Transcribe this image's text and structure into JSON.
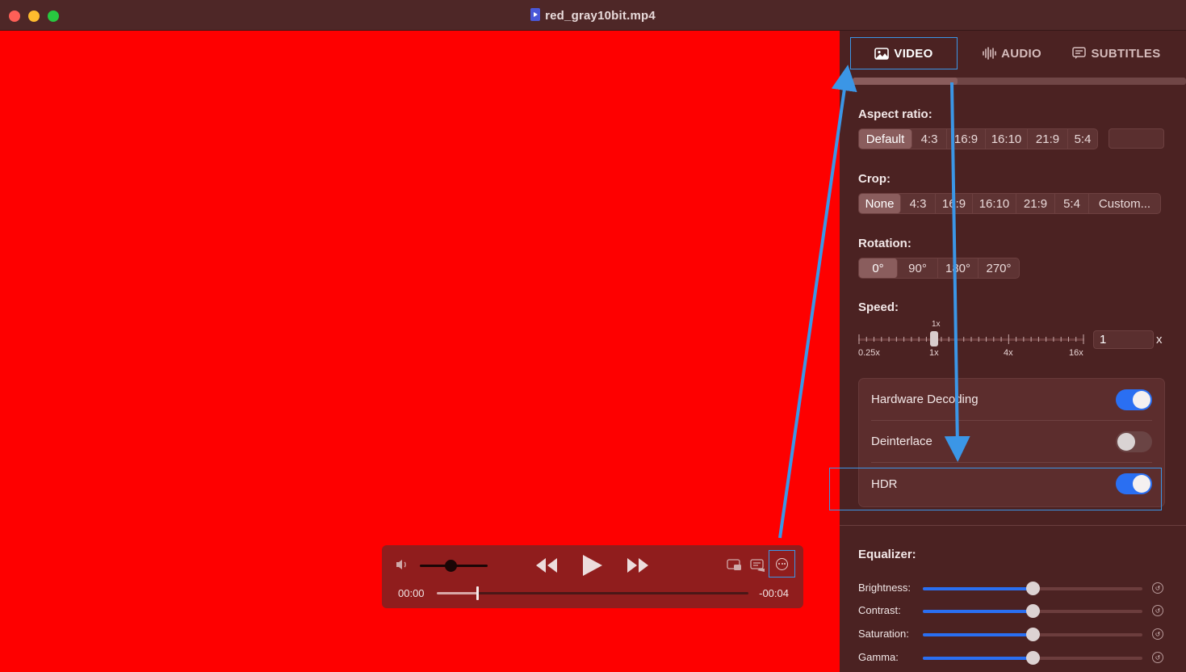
{
  "window": {
    "title": "red_gray10bit.mp4"
  },
  "colors": {
    "video_bg": "#fe0000",
    "accent": "#2a6ff2",
    "highlight": "#3b96e6"
  },
  "controls": {
    "time_current": "00:00",
    "time_remaining": "-00:04",
    "volume_level": 0.45,
    "seek_progress": 0.13,
    "icons": [
      "speaker-icon",
      "rewind-icon",
      "play-icon",
      "fast-forward-icon",
      "picture-in-picture-icon",
      "subtitles-icon",
      "more-options-icon"
    ]
  },
  "tabs": [
    {
      "label": "VIDEO",
      "icon": "image-icon",
      "selected": true
    },
    {
      "label": "AUDIO",
      "icon": "waveform-icon",
      "selected": false
    },
    {
      "label": "SUBTITLES",
      "icon": "caption-bubble-icon",
      "selected": false
    }
  ],
  "aspect": {
    "label": "Aspect ratio:",
    "options": [
      "Default",
      "4:3",
      "16:9",
      "16:10",
      "21:9",
      "5:4"
    ],
    "selected": "Default",
    "custom_value": ""
  },
  "crop": {
    "label": "Crop:",
    "options": [
      "None",
      "4:3",
      "16:9",
      "16:10",
      "21:9",
      "5:4",
      "Custom..."
    ],
    "selected": "None"
  },
  "rotation": {
    "label": "Rotation:",
    "options": [
      "0°",
      "90°",
      "180°",
      "270°"
    ],
    "selected": "0°"
  },
  "speed": {
    "label": "Speed:",
    "current_marker": "1x",
    "tick_labels": [
      "0.25x",
      "1x",
      "4x",
      "16x"
    ],
    "value": "1",
    "unit": "x"
  },
  "toggles": [
    {
      "label": "Hardware Decoding",
      "on": true
    },
    {
      "label": "Deinterlace",
      "on": false
    },
    {
      "label": "HDR",
      "on": true
    }
  ],
  "equalizer": {
    "label": "Equalizer:",
    "rows": [
      {
        "label": "Brightness:",
        "value": 0.5
      },
      {
        "label": "Contrast:",
        "value": 0.5
      },
      {
        "label": "Saturation:",
        "value": 0.5
      },
      {
        "label": "Gamma:",
        "value": 0.5
      }
    ]
  }
}
